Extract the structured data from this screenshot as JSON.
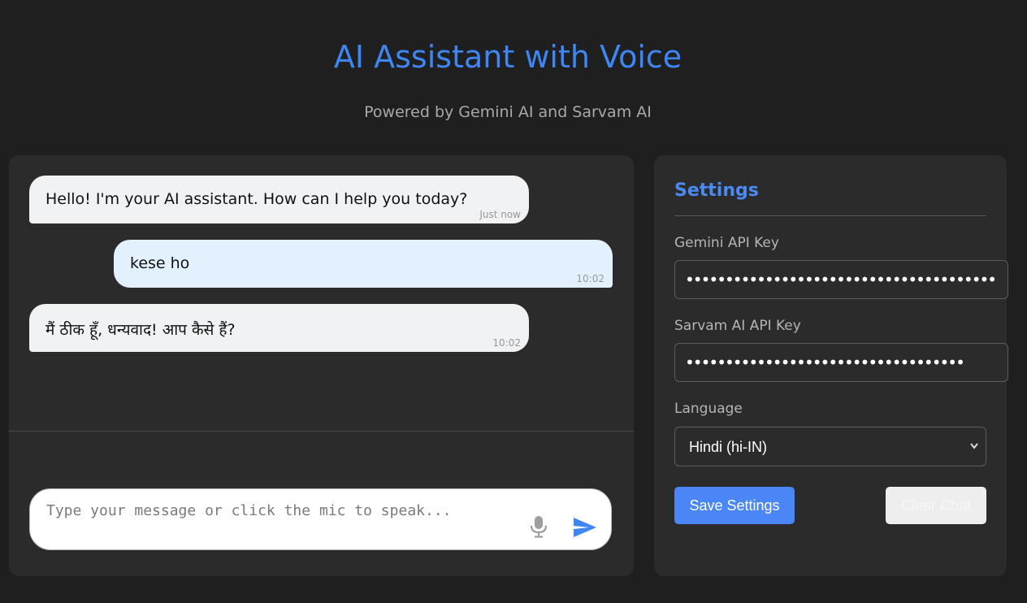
{
  "header": {
    "title": "AI Assistant with Voice",
    "subtitle": "Powered by Gemini AI and Sarvam AI"
  },
  "chat": {
    "messages": [
      {
        "role": "assistant",
        "text": "Hello! I'm your AI assistant. How can I help you today?",
        "time": "Just now"
      },
      {
        "role": "user",
        "text": "kese ho",
        "time": "10:02"
      },
      {
        "role": "assistant",
        "text": "मैं ठीक हूँ, धन्यवाद! आप कैसे हैं?",
        "time": "10:02"
      }
    ],
    "input": {
      "value": "",
      "placeholder": "Type your message or click the mic to speak..."
    },
    "icons": {
      "mic": "mic-icon",
      "send": "send-icon"
    }
  },
  "settings": {
    "title": "Settings",
    "gemini": {
      "label": "Gemini API Key",
      "value": "•••••••••••••••••••••••••••••••••••••••"
    },
    "sarvam": {
      "label": "Sarvam AI API Key",
      "value": "•••••••••••••••••••••••••••••••••••"
    },
    "language": {
      "label": "Language",
      "selected": "Hindi (hi-IN)"
    },
    "save_label": "Save Settings",
    "clear_label": "Clear Chat"
  },
  "colors": {
    "accent": "#4a86f5",
    "background": "#1f1f1f",
    "panel": "#2b2b2b",
    "user_bubble": "#e3f0fd",
    "ai_bubble": "#f1f2f4"
  }
}
